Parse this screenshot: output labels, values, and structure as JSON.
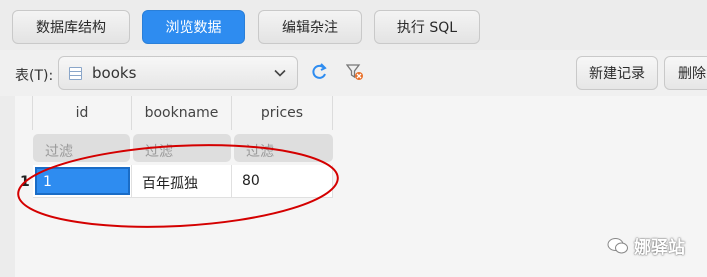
{
  "tabs": [
    {
      "label": "数据库结构",
      "active": false
    },
    {
      "label": "浏览数据",
      "active": true
    },
    {
      "label": "编辑杂注",
      "active": false
    },
    {
      "label": "执行 SQL",
      "active": false
    }
  ],
  "toolbar": {
    "table_label": "表(T):",
    "table_select_value": "books",
    "new_record_label": "新建记录",
    "delete_label": "删除"
  },
  "grid": {
    "columns": [
      "id",
      "bookname",
      "prices"
    ],
    "filter_placeholder": "过滤",
    "rows": [
      {
        "row_number": "1",
        "cells": [
          "1",
          "百年孤独",
          "80"
        ]
      }
    ]
  },
  "annotation_color": "#d40000",
  "accent_color": "#2e8cf0",
  "watermark": "娜驿站"
}
